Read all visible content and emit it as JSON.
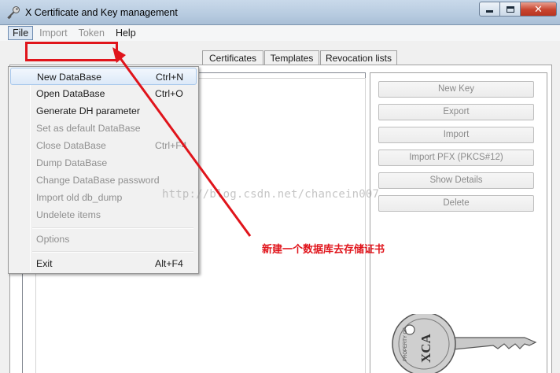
{
  "window": {
    "title": "X Certificate and Key management",
    "close_glyph": "✕",
    "icon": "key-app-icon"
  },
  "menubar": {
    "items": [
      {
        "label": "File",
        "state": "active"
      },
      {
        "label": "Import",
        "state": "disabled"
      },
      {
        "label": "Token",
        "state": "disabled"
      },
      {
        "label": "Help",
        "state": "enabled"
      }
    ]
  },
  "tabs": [
    "Certificates",
    "Templates",
    "Revocation lists"
  ],
  "side_buttons": [
    "New Key",
    "Export",
    "Import",
    "Import PFX (PKCS#12)",
    "Show Details",
    "Delete"
  ],
  "file_menu": {
    "items": [
      {
        "label": "New DataBase",
        "shortcut": "Ctrl+N",
        "enabled": true,
        "highlighted": true
      },
      {
        "label": "Open DataBase",
        "shortcut": "Ctrl+O",
        "enabled": true
      },
      {
        "label": "Generate DH parameter",
        "shortcut": "",
        "enabled": true
      },
      {
        "label": "Set as default DataBase",
        "shortcut": "",
        "enabled": false
      },
      {
        "label": "Close DataBase",
        "shortcut": "Ctrl+F4",
        "enabled": false
      },
      {
        "label": "Dump DataBase",
        "shortcut": "",
        "enabled": false
      },
      {
        "label": "Change DataBase password",
        "shortcut": "",
        "enabled": false
      },
      {
        "label": "Import old db_dump",
        "shortcut": "",
        "enabled": false
      },
      {
        "label": "Undelete items",
        "shortcut": "",
        "enabled": false
      },
      {
        "label": "Options",
        "shortcut": "",
        "enabled": false
      },
      {
        "label": "Exit",
        "shortcut": "Alt+F4",
        "enabled": true
      }
    ]
  },
  "key_graphic": {
    "text_small": "PROPERTY OF",
    "text_large": "XCA"
  },
  "watermark": "http://blog.csdn.net/chancein007",
  "annotation": {
    "text": "新建一个数据库去存储证书",
    "color": "#e0141b"
  }
}
